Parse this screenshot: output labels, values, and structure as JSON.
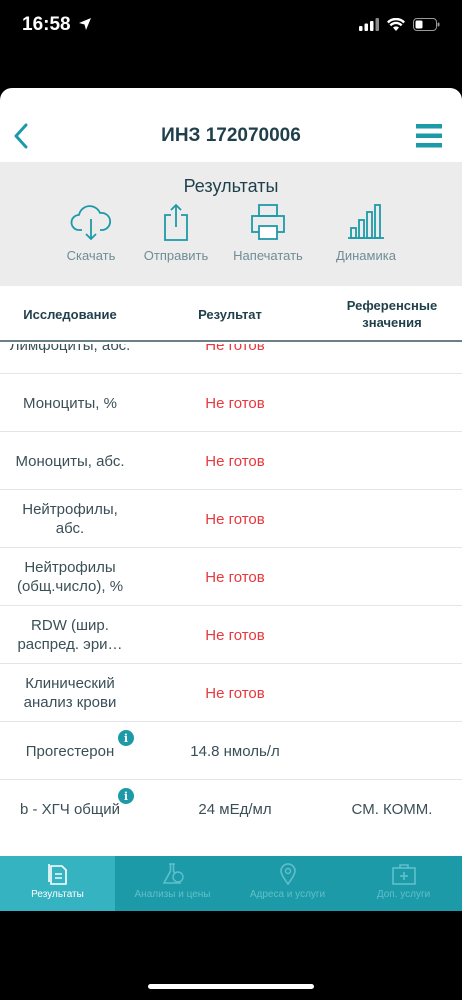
{
  "status_bar": {
    "time": "16:58"
  },
  "nav": {
    "title": "ИНЗ 172070006"
  },
  "results": {
    "title": "Результаты",
    "actions": [
      {
        "label": "Скачать",
        "icon": "cloud-download-icon"
      },
      {
        "label": "Отправить",
        "icon": "share-icon"
      },
      {
        "label": "Напечатать",
        "icon": "printer-icon"
      },
      {
        "label": "Динамика",
        "icon": "bar-chart-icon"
      }
    ]
  },
  "table": {
    "headers": [
      "Исследование",
      "Результат",
      "Референсные значения"
    ],
    "rows": [
      {
        "name": "Лимфоциты, абс.",
        "result": "Не готов",
        "reference": ""
      },
      {
        "name": "Моноциты, %",
        "result": "Не готов",
        "reference": ""
      },
      {
        "name": "Моноциты, абс.",
        "result": "Не готов",
        "reference": ""
      },
      {
        "name": "Нейтрофилы, абс.",
        "result": "Не готов",
        "reference": ""
      },
      {
        "name": "Нейтрофилы (общ.число), %",
        "result": "Не готов",
        "reference": ""
      },
      {
        "name": "RDW (шир. распред. эри…",
        "result": "Не готов",
        "reference": ""
      },
      {
        "name": "Клинический анализ крови",
        "result": "Не готов",
        "reference": ""
      },
      {
        "name": "Прогестерон",
        "result": "14.8 нмоль/л",
        "reference": "",
        "info": "i"
      },
      {
        "name": "b - ХГЧ общий",
        "result": "24 мЕд/мл",
        "reference": "СМ. КОММ.",
        "info": "i"
      }
    ]
  },
  "tabbar": {
    "items": [
      {
        "label": "Результаты",
        "icon": "document-icon",
        "active": true
      },
      {
        "label": "Анализы и цены",
        "icon": "flask-icon",
        "active": false
      },
      {
        "label": "Адреса и услуги",
        "icon": "map-pin-icon",
        "active": false
      },
      {
        "label": "Доп. услуги",
        "icon": "medical-kit-icon",
        "active": false
      }
    ]
  },
  "colors": {
    "accent": "#1d9aa7",
    "status_red": "#e8383d"
  }
}
